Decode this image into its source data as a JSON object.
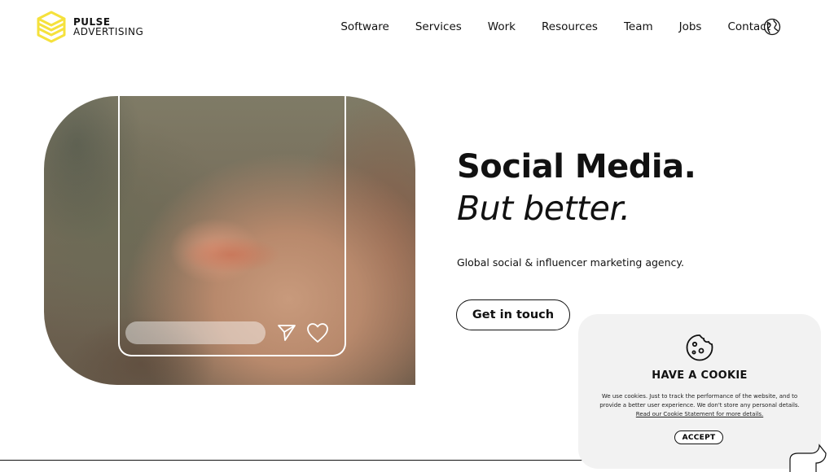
{
  "brand": {
    "line1": "PULSE",
    "line2": "ADVERTISING",
    "accent_color": "#f5e13c"
  },
  "nav": {
    "items": [
      {
        "label": "Software"
      },
      {
        "label": "Services"
      },
      {
        "label": "Work"
      },
      {
        "label": "Resources"
      },
      {
        "label": "Team"
      },
      {
        "label": "Jobs"
      },
      {
        "label": "Contact"
      }
    ],
    "language_icon": "globe-icon"
  },
  "hero": {
    "title": "Social Media.",
    "subtitle": "But better.",
    "tagline": "Global social & influencer marketing agency.",
    "cta_label": "Get in touch",
    "media_icons": [
      "send-icon",
      "heart-icon"
    ]
  },
  "cookie_banner": {
    "icon": "cookie-icon",
    "title": "HAVE A COOKIE",
    "body": "We use cookies. Just to track the performance of the website, and to provide a better user experience. We don't store any personal details.",
    "link_text": "Read our Cookie Statement for more details.",
    "accept_label": "ACCEPT",
    "background_color": "#f2f2f2"
  }
}
